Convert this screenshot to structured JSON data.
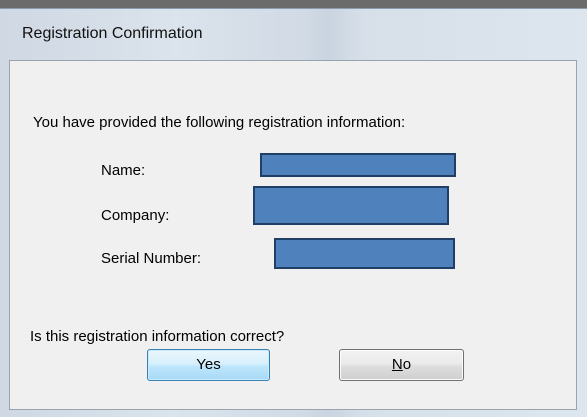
{
  "window": {
    "title": "Registration Confirmation"
  },
  "message": {
    "intro": "You have provided the following registration information:",
    "question": "Is this registration information correct?"
  },
  "fields": {
    "name_label": "Name:",
    "company_label": "Company:",
    "serial_label": "Serial Number:"
  },
  "buttons": {
    "yes_label": "Yes",
    "no_mnemonic": "N",
    "no_rest": "o"
  },
  "colors": {
    "redaction_fill": "#4f81bd",
    "redaction_border": "#1f3f66",
    "default_button_border": "#3c7fb1"
  }
}
